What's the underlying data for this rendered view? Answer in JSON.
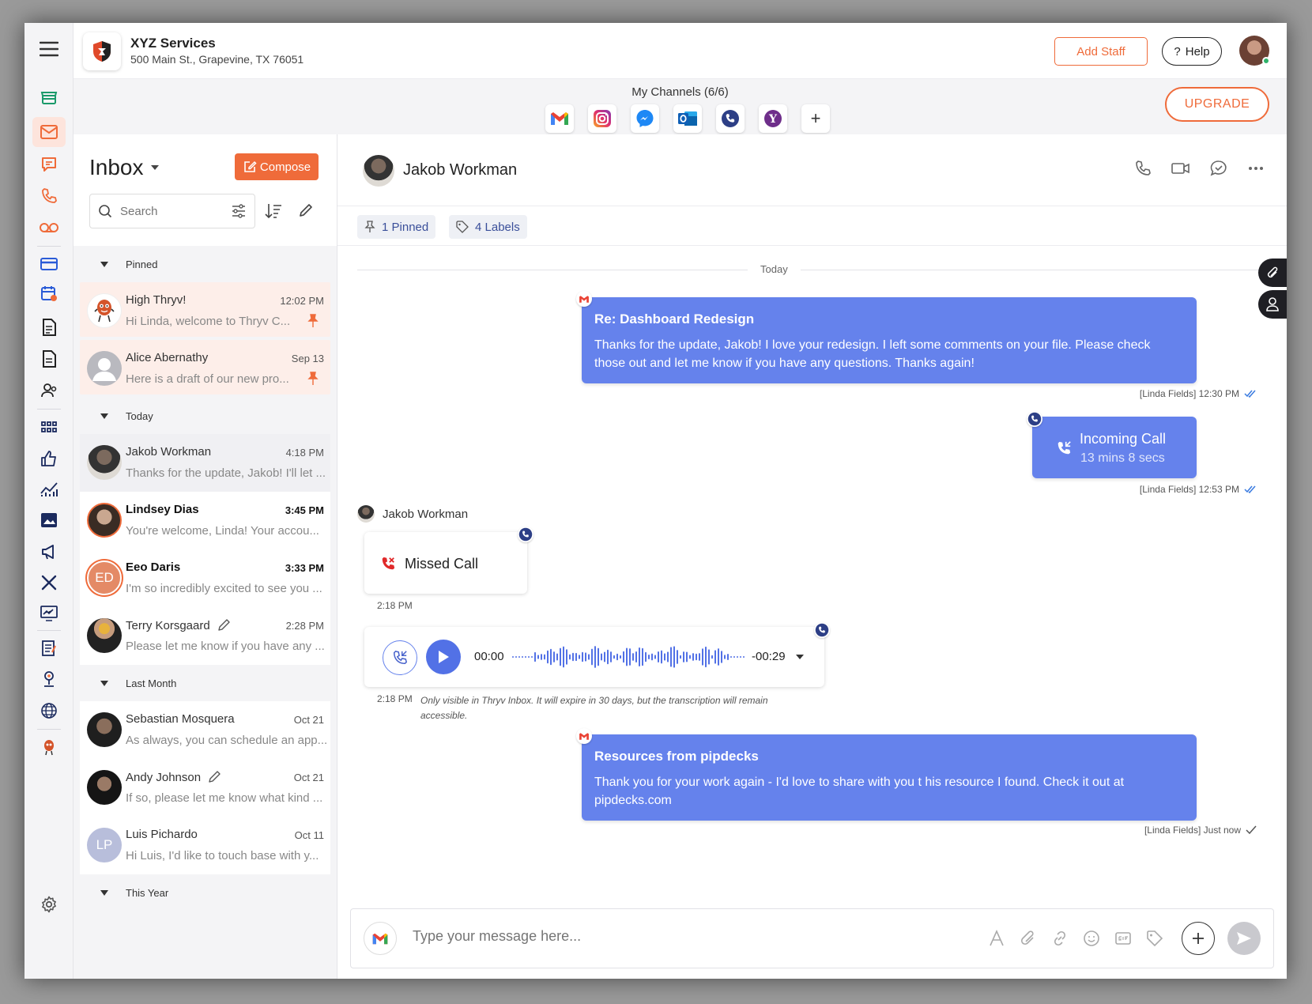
{
  "business": {
    "name": "XYZ Services",
    "address": "500 Main St., Grapevine, TX 76051"
  },
  "header": {
    "add_staff": "Add Staff",
    "help": "Help",
    "help_icon": "?"
  },
  "channels": {
    "title": "My Channels (6/6)",
    "upgrade": "UPGRADE",
    "add": "+",
    "icons": [
      "gmail-icon",
      "instagram-icon",
      "messenger-icon",
      "outlook-icon",
      "phone-icon",
      "yahoo-icon"
    ]
  },
  "inbox": {
    "title": "Inbox",
    "compose": "Compose",
    "search_placeholder": "Search",
    "sections": {
      "pinned": "Pinned",
      "today": "Today",
      "last_month": "Last Month",
      "this_year": "This Year"
    },
    "pinned": [
      {
        "name": "High Thryv!",
        "time": "12:02 PM",
        "preview": "Hi Linda, welcome to Thryv C..."
      },
      {
        "name": "Alice Abernathy",
        "time": "Sep 13",
        "preview": "Here is a draft of our new pro..."
      }
    ],
    "today": [
      {
        "name": "Jakob Workman",
        "time": "4:18 PM",
        "preview": "Thanks for the update, Jakob! I'll let ..."
      },
      {
        "name": "Lindsey Dias",
        "time": "3:45 PM",
        "preview": "You're welcome, Linda! Your accou..."
      },
      {
        "name": "Eeo Daris",
        "initials": "ED",
        "time": "3:33 PM",
        "preview": "I'm so incredibly excited to see you ..."
      },
      {
        "name": "Terry Korsgaard",
        "time": "2:28 PM",
        "preview": "Please let me know if you have any ..."
      }
    ],
    "last_month": [
      {
        "name": "Sebastian Mosquera",
        "time": "Oct 21",
        "preview": "As always, you can schedule an app..."
      },
      {
        "name": "Andy Johnson",
        "time": "Oct 21",
        "preview": "If so, please let me know what kind ..."
      },
      {
        "name": "Luis Pichardo",
        "initials": "LP",
        "time": "Oct 11",
        "preview": "Hi Luis, I'd like to touch base with y..."
      }
    ]
  },
  "conversation": {
    "contact": "Jakob Workman",
    "pinned": "1 Pinned",
    "labels": "4 Labels",
    "day": "Today",
    "messages": {
      "email1": {
        "subject": "Re: Dashboard Redesign",
        "body": "Thanks for the update, Jakob! I love your redesign. I left some comments on your file. Please check those out and let me know if you have any questions. Thanks again!",
        "meta": "[Linda Fields] 12:30 PM"
      },
      "call_in": {
        "title": "Incoming Call",
        "duration": "13 mins 8 secs",
        "meta": "[Linda Fields] 12:53 PM"
      },
      "sender": "Jakob Workman",
      "missed": {
        "title": "Missed Call",
        "time": "2:18 PM"
      },
      "voicemail": {
        "start": "00:00",
        "remaining": "-00:29",
        "time": "2:18 PM",
        "note": "Only visible in Thryv Inbox. It will expire in 30 days, but the transcription will remain accessible."
      },
      "email2": {
        "subject": "Resources from pipdecks",
        "body": "Thank you for your work again - I'd love to share with you t his resource I found. Check it out at pipdecks.com",
        "meta": "[Linda Fields] Just now"
      }
    },
    "composer_placeholder": "Type your message here..."
  },
  "colors": {
    "brand_orange": "#ef6b3a",
    "bubble_blue": "#6582ec",
    "rail_bg": "#f4f4f6"
  }
}
